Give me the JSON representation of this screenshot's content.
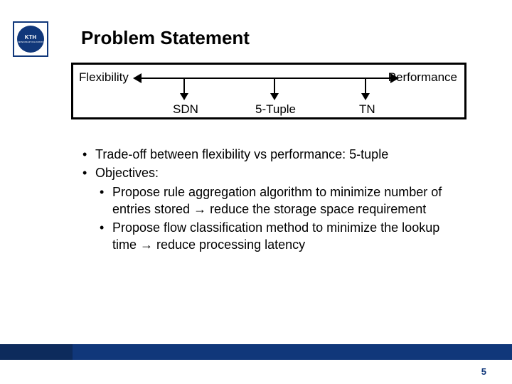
{
  "logo": {
    "text": "KTH",
    "subtext": "VETENSKAP OCH KONST"
  },
  "title": "Problem Statement",
  "diagram": {
    "left_label": "Flexibility",
    "right_label": "Performance",
    "ticks": {
      "a": "SDN",
      "b": "5-Tuple",
      "c": "TN"
    }
  },
  "bullets": {
    "b1": "Trade-off between flexibility vs performance: 5-tuple",
    "b2": "Objectives:",
    "b2a_pre": "Propose rule aggregation algorithm to minimize number of entries stored ",
    "b2a_post": " reduce the storage space requirement",
    "b2b_pre": "Propose flow classification method to minimize the lookup time ",
    "b2b_post": " reduce processing latency",
    "arrow": "→"
  },
  "page_number": "5"
}
